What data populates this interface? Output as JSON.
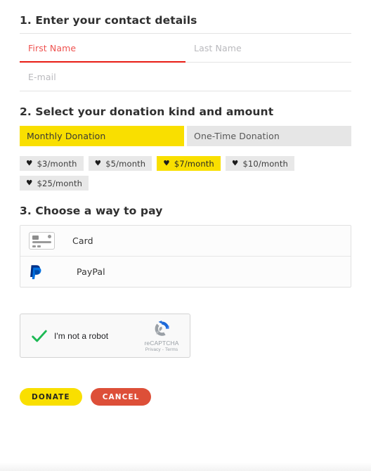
{
  "steps": {
    "contact": {
      "title": "1. Enter your contact details",
      "fields": {
        "first_name": {
          "placeholder": "First Name",
          "value": "",
          "state": "focused"
        },
        "last_name": {
          "placeholder": "Last Name",
          "value": ""
        },
        "email": {
          "placeholder": "E-mail",
          "value": ""
        }
      }
    },
    "donation": {
      "title": "2. Select your donation kind and amount",
      "kinds": [
        {
          "label": "Monthly Donation",
          "selected": true
        },
        {
          "label": "One-Time Donation",
          "selected": false
        }
      ],
      "amounts": [
        {
          "label": "$3/month",
          "selected": false
        },
        {
          "label": "$5/month",
          "selected": false
        },
        {
          "label": "$7/month",
          "selected": true
        },
        {
          "label": "$10/month",
          "selected": false
        },
        {
          "label": "$25/month",
          "selected": false
        }
      ],
      "heart_glyph": "♥"
    },
    "payment": {
      "title": "3. Choose a way to pay",
      "methods": [
        {
          "label": "Card",
          "icon": "credit-card-icon"
        },
        {
          "label": "PayPal",
          "icon": "paypal-icon"
        }
      ]
    }
  },
  "recaptcha": {
    "label": "I'm not a robot",
    "brand": "reCAPTCHA",
    "privacy": "Privacy",
    "separator": "-",
    "terms": "Terms",
    "checked": true
  },
  "actions": {
    "donate_label": "DONATE",
    "cancel_label": "CANCEL"
  },
  "colors": {
    "accent_yellow": "#f9df00",
    "accent_red": "#e81c14",
    "cancel_red": "#dd4f38",
    "chip_grey": "#e8e8e8",
    "tab_grey": "#e6e6e6"
  }
}
